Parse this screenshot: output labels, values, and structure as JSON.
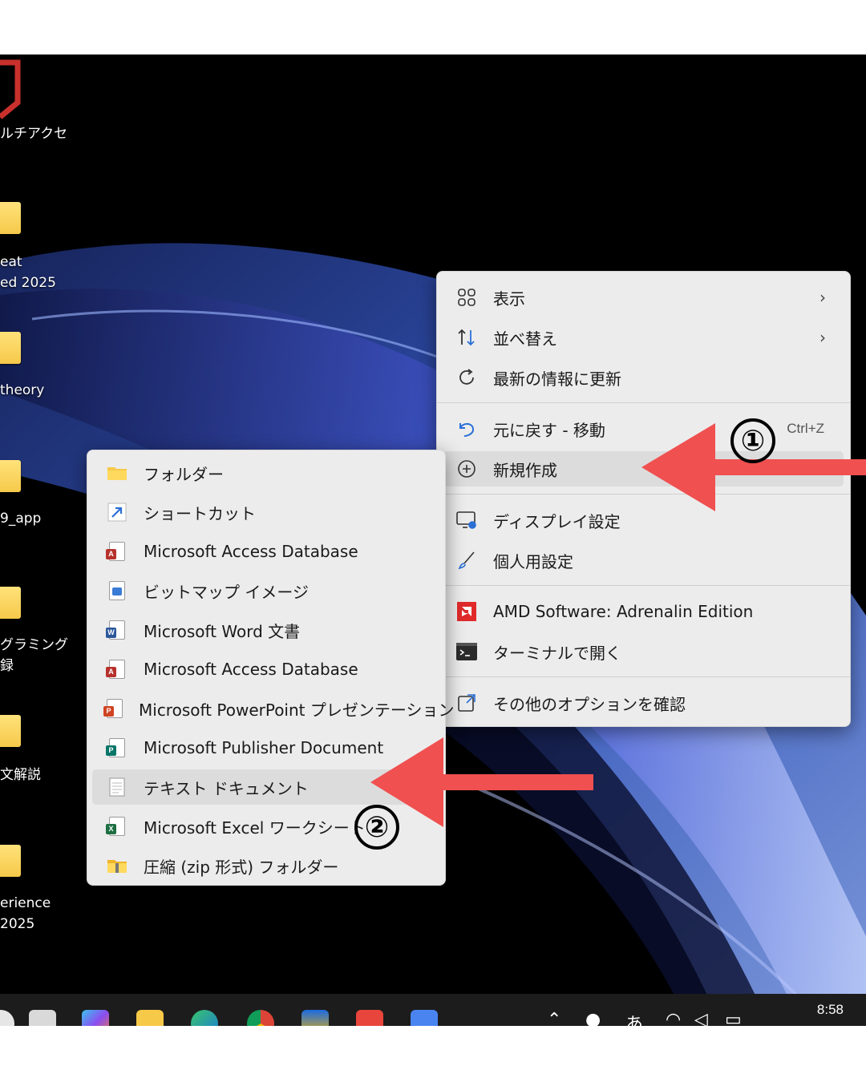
{
  "desktop": {
    "icons": [
      {
        "label_lines": [
          "ルチアクセ"
        ]
      },
      {
        "label_lines": [
          "eat",
          "ed 2025"
        ]
      },
      {
        "label_lines": [
          "theory"
        ]
      },
      {
        "label_lines": [
          "9_app"
        ]
      },
      {
        "label_lines": [
          "グラミング",
          "録"
        ]
      },
      {
        "label_lines": [
          "文解説"
        ]
      },
      {
        "label_lines": [
          "erience",
          "2025"
        ]
      }
    ]
  },
  "context_menu": {
    "items": [
      {
        "label": "表示",
        "icon": "grid-view-icon",
        "has_submenu": true
      },
      {
        "label": "並べ替え",
        "icon": "sort-icon",
        "has_submenu": true
      },
      {
        "label": "最新の情報に更新",
        "icon": "refresh-icon"
      },
      {
        "label": "元に戻す - 移動",
        "icon": "undo-icon",
        "shortcut": "Ctrl+Z"
      },
      {
        "label": "新規作成",
        "icon": "add-circle-icon",
        "highlighted": true
      },
      {
        "label": "ディスプレイ設定",
        "icon": "display-settings-icon"
      },
      {
        "label": "個人用設定",
        "icon": "brush-icon"
      },
      {
        "label": "AMD Software: Adrenalin Edition",
        "icon": "amd-icon"
      },
      {
        "label": "ターミナルで開く",
        "icon": "terminal-icon"
      },
      {
        "label": "その他のオプションを確認",
        "icon": "more-options-icon"
      }
    ]
  },
  "submenu": {
    "items": [
      {
        "label": "フォルダー",
        "icon": "folder-icon"
      },
      {
        "label": "ショートカット",
        "icon": "shortcut-icon"
      },
      {
        "label": "Microsoft Access Database",
        "icon": "access-icon"
      },
      {
        "label": "ビットマップ イメージ",
        "icon": "bitmap-icon"
      },
      {
        "label": "Microsoft Word 文書",
        "icon": "word-icon"
      },
      {
        "label": "Microsoft Access Database",
        "icon": "access-icon"
      },
      {
        "label": "Microsoft PowerPoint プレゼンテーション",
        "icon": "powerpoint-icon"
      },
      {
        "label": "Microsoft Publisher Document",
        "icon": "publisher-icon"
      },
      {
        "label": "テキスト ドキュメント",
        "icon": "text-document-icon",
        "highlighted": true
      },
      {
        "label": "Microsoft Excel ワークシート",
        "icon": "excel-icon"
      },
      {
        "label": "圧縮 (zip 形式) フォルダー",
        "icon": "zip-folder-icon"
      }
    ]
  },
  "annotations": {
    "step1": "①",
    "step2": "②",
    "arrow_color": "#f05050"
  },
  "taskbar": {
    "clock": "8:58",
    "ime": "あ"
  }
}
